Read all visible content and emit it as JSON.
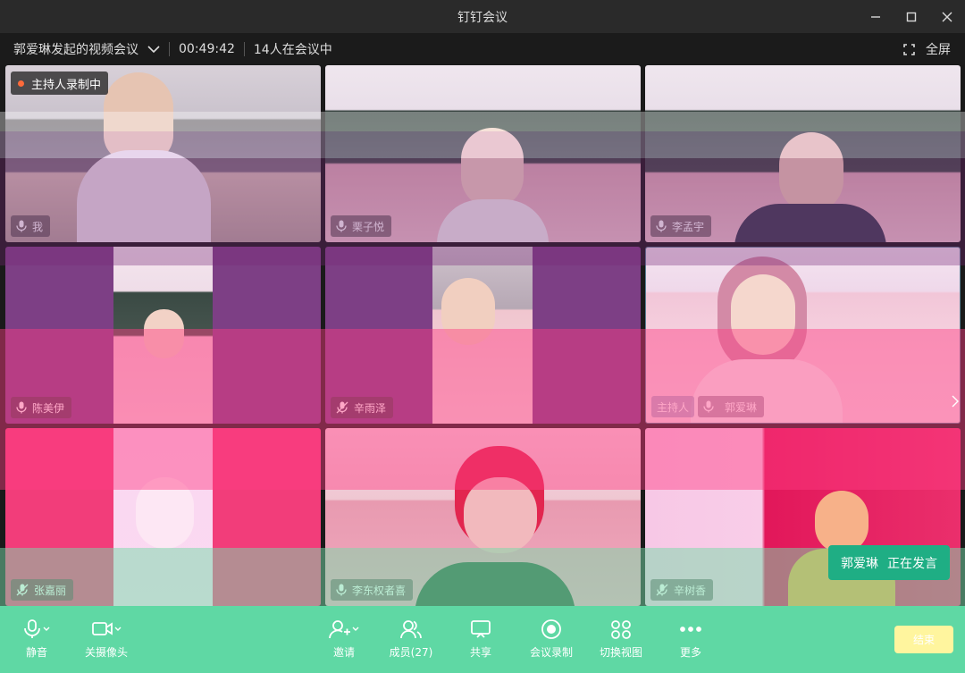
{
  "window": {
    "title": "钉钉会议"
  },
  "info": {
    "meeting_title": "郭爱琳发起的视频会议",
    "elapsed": "00:49:42",
    "count_text": "14人在会议中",
    "fullscreen": "全屏"
  },
  "recording_badge": "主持人录制中",
  "tiles": [
    {
      "name": "我",
      "mic": "on"
    },
    {
      "name": "栗子悦",
      "mic": "on"
    },
    {
      "name": "李孟宇",
      "mic": "on"
    },
    {
      "name": "陈美伊",
      "mic": "on"
    },
    {
      "name": "辛雨泽",
      "mic": "muted"
    },
    {
      "name": "郭爱琳",
      "mic": "on",
      "host_tag": "主持人"
    },
    {
      "name": "张嘉丽",
      "mic": "muted"
    },
    {
      "name": "李东权者喜",
      "mic": "on"
    },
    {
      "name": "辛树香",
      "mic": "muted"
    }
  ],
  "speaking": {
    "name": "郭爱琳",
    "status": "正在发言"
  },
  "toolbar": {
    "mute": "静音",
    "camera_off": "关摄像头",
    "invite": "邀请",
    "members": "成员(27)",
    "share": "共享",
    "record": "会议录制",
    "switch_view": "切换视图",
    "more": "更多",
    "leave": "结束"
  },
  "colors": {
    "toolbar": "#5fd8a4",
    "speaking": "#1fae84",
    "rec_dot": "#ff6a3a",
    "leave": "#fff59e"
  }
}
